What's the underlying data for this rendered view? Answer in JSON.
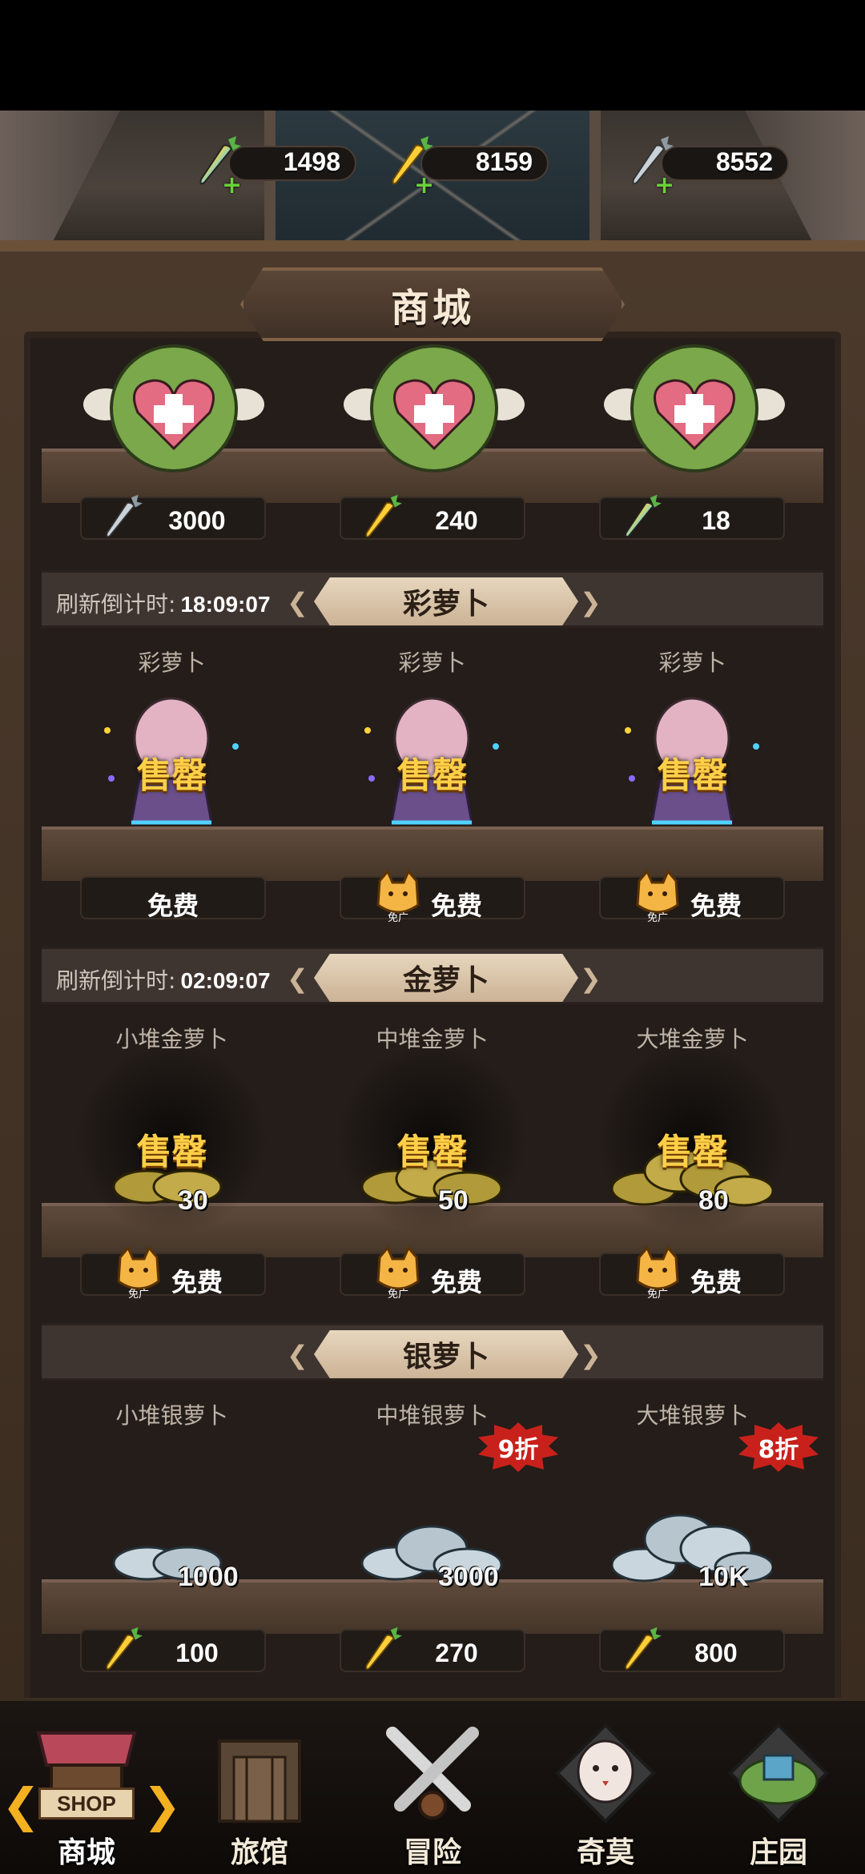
{
  "currencies": [
    {
      "name": "rainbow-carrot",
      "value": "1498",
      "colors": [
        "#ff4fb0",
        "#ffd43b",
        "#4fd1ff",
        "#8a6bff"
      ]
    },
    {
      "name": "gold-carrot",
      "value": "8159",
      "colors": [
        "#ffcf3a"
      ]
    },
    {
      "name": "silver-carrot",
      "value": "8552",
      "colors": [
        "#c9d2d8"
      ]
    }
  ],
  "title": "商城",
  "top_section": {
    "items": [
      {
        "price": "3000",
        "currency": "silver"
      },
      {
        "price": "240",
        "currency": "gold"
      },
      {
        "price": "18",
        "currency": "rainbow"
      }
    ]
  },
  "rainbow_section": {
    "timer_label": "刷新倒计时:",
    "timer_value": "18:09:07",
    "title": "彩萝卜",
    "items": [
      {
        "name": "彩萝卜",
        "status": "售罄",
        "price": "免费",
        "ad": false
      },
      {
        "name": "彩萝卜",
        "status": "售罄",
        "price": "免费",
        "ad": true
      },
      {
        "name": "彩萝卜",
        "status": "售罄",
        "price": "免费",
        "ad": true
      }
    ]
  },
  "gold_section": {
    "timer_label": "刷新倒计时:",
    "timer_value": "02:09:07",
    "title": "金萝卜",
    "items": [
      {
        "name": "小堆金萝卜",
        "status": "售罄",
        "qty": "30",
        "price": "免费"
      },
      {
        "name": "中堆金萝卜",
        "status": "售罄",
        "qty": "50",
        "price": "免费"
      },
      {
        "name": "大堆金萝卜",
        "status": "售罄",
        "qty": "80",
        "price": "免费"
      }
    ]
  },
  "silver_section": {
    "title": "银萝卜",
    "items": [
      {
        "name": "小堆银萝卜",
        "qty": "1000",
        "price": "100",
        "discount": ""
      },
      {
        "name": "中堆银萝卜",
        "qty": "3000",
        "price": "270",
        "discount": "9折"
      },
      {
        "name": "大堆银萝卜",
        "qty": "10K",
        "price": "800",
        "discount": "8折"
      }
    ]
  },
  "ad_label": "免广",
  "shop_word": "SHOP",
  "nav": [
    {
      "label": "商城",
      "active": true
    },
    {
      "label": "旅馆",
      "active": false
    },
    {
      "label": "冒险",
      "active": false
    },
    {
      "label": "奇莫",
      "active": false
    },
    {
      "label": "庄园",
      "active": false
    }
  ]
}
